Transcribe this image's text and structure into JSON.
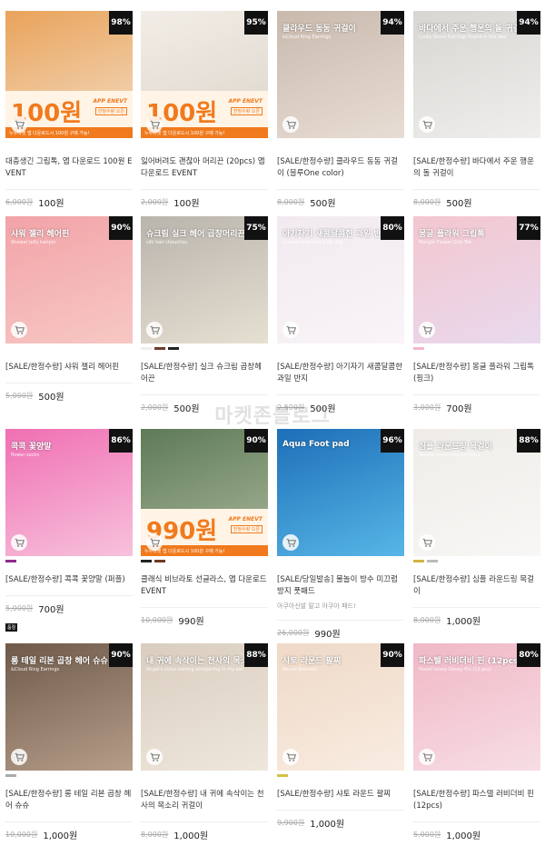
{
  "watermark": "마켓존블로그",
  "products": [
    {
      "name": "대충생긴 그립톡, 앱 다운로드 100원 EVENT",
      "old": "6,000원",
      "price": "100원",
      "discount": "98%",
      "promo": {
        "big": "100원",
        "tag": "APP ENEVT",
        "tag2": "한정수량 오픈",
        "bar": "누누마켓 앱 다운로드시 100원 구매 가능!"
      },
      "colors": [
        "#e9a35a",
        "#f3dcc3"
      ],
      "swatches": []
    },
    {
      "name": "잃어버려도 괜찮아 머리끈 (20pcs) 앱 다운로드 EVENT",
      "old": "2,000원",
      "price": "100원",
      "discount": "95%",
      "promo": {
        "big": "100원",
        "tag": "APP ENEVT",
        "tag2": "한정수량 오픈",
        "bar": "누누마켓 앱 다운로드시 100원 구매 가능!"
      },
      "colors": [
        "#f2ede6",
        "#dcd5cb"
      ],
      "swatches": []
    },
    {
      "name": "[SALE/한정수량] 클라우드 동동 귀걸이 (블루One color)",
      "old": "8,000원",
      "price": "500원",
      "discount": "94%",
      "overlay": "클라우드 동동 귀걸이",
      "overlay_sub": "&Cloud Ring Earrings",
      "colors": [
        "#c9b9ad",
        "#e8ddd4"
      ],
      "swatches": []
    },
    {
      "name": "[SALE/한정수량] 바다에서 주운 행운의 돌 귀걸이",
      "old": "8,000원",
      "price": "500원",
      "discount": "94%",
      "overlay": "바다에서 주운 행운의 돌 귀걸이",
      "overlay_sub": "Lucky Stone Earrings Found in the Sea",
      "colors": [
        "#d8d6d2",
        "#efeeec"
      ],
      "swatches": []
    },
    {
      "name": "[SALE/한정수량] 샤워 젤리 헤어핀",
      "old": "5,000원",
      "price": "500원",
      "discount": "90%",
      "overlay": "샤워 젤리 헤어핀",
      "overlay_sub": "Shower jelly hairpin",
      "colors": [
        "#f2a3a8",
        "#f7c8c4"
      ],
      "swatches": []
    },
    {
      "name": "[SALE/한정수량] 실크 슈크림 곱창헤어끈",
      "old": "2,000원",
      "price": "500원",
      "discount": "75%",
      "overlay": "슈크림 실크 헤어 곱창머리끈",
      "overlay_sub": "silk hair chouchou",
      "colors": [
        "#b9b4ac",
        "#e6e0d2"
      ],
      "swatches": [
        "#eeeeee",
        "#6b3b2a",
        "#222222"
      ]
    },
    {
      "name": "[SALE/한정수량] 아기자기 새콤달콤한 과일 반지",
      "old": "2,500원",
      "price": "500원",
      "discount": "80%",
      "overlay": "아기자기 새콤달콤한 과일 반지",
      "overlay_sub": "a sweet and sour fruit ring",
      "colors": [
        "#f1eaf0",
        "#f9f4f7"
      ],
      "swatches": []
    },
    {
      "name": "[SALE/한정수량] 몽글 플라워 그립톡 (핑크)",
      "old": "3,000원",
      "price": "700원",
      "discount": "77%",
      "overlay": "몽글 플라워 그립톡",
      "overlay_sub": "Mongle Flower Grip Tok",
      "colors": [
        "#f3c7cf",
        "#e9d9ee"
      ],
      "swatches": [
        "#f5b6c8"
      ]
    },
    {
      "name": "[SALE/한정수량] 콕콕 꽃양말 (퍼플)",
      "old": "5,000원",
      "price": "700원",
      "discount": "86%",
      "overlay": "콕콕 꽃양말",
      "overlay_sub": "flower socks",
      "colors": [
        "#f06fb3",
        "#f7c2dc"
      ],
      "swatches": [
        "#8e2b8e"
      ],
      "soldtag": "품절"
    },
    {
      "name": "클래식 비브라토 선글라스, 앱 다운로드 EVENT",
      "old": "10,000원",
      "price": "990원",
      "discount": "90%",
      "promo": {
        "big": "990원",
        "tag": "APP ENEVT",
        "tag2": "한정수량 오픈",
        "bar": "누누마켓 앱 다운로드시 100원 구매 가능!"
      },
      "colors": [
        "#5e7a56",
        "#a9b79a"
      ],
      "swatches": [
        "#222222",
        "#6b3b2a"
      ]
    },
    {
      "name": "[SALE/당일발송] 물놀이 방수 미끄럼 방지 풋패드",
      "desc": "아쿠아신발 말고 아쿠아 패드!",
      "old": "26,000원",
      "price": "990원",
      "discount": "96%",
      "overlay": "Aqua Foot pad",
      "overlay_sub": "",
      "colors": [
        "#1d6fb8",
        "#57b6e6"
      ],
      "swatches": []
    },
    {
      "name": "[SALE/한정수량] 심플 라운드링 목걸이",
      "old": "8,000원",
      "price": "1,000원",
      "discount": "88%",
      "overlay": "심플 라운드링 목걸이",
      "overlay_sub": "Simple round ring necklace",
      "colors": [
        "#efece8",
        "#f8f7f5"
      ],
      "swatches": [
        "#d4b445",
        "#bbbbbb"
      ]
    },
    {
      "name": "[SALE/한정수량] 롱 테일 리본 곱창 헤어 슈슈",
      "old": "10,000원",
      "price": "1,000원",
      "discount": "90%",
      "overlay": "롱 테일 리본 곱창 헤어 슈슈",
      "overlay_sub": "&Cloud Ring Earrings",
      "colors": [
        "#6f5a4a",
        "#b59d89"
      ],
      "swatches": [
        "#aaaaaa"
      ]
    },
    {
      "name": "[SALE/한정수량] 내 귀에 속삭이는 천사의 목소리 귀걸이",
      "old": "8,000원",
      "price": "1,000원",
      "discount": "88%",
      "overlay": "내 귀에 속삭이는 천사의 목소리",
      "overlay_sub": "Angel's voice earring whispering in my ear",
      "colors": [
        "#d9cdbf",
        "#efe7dc"
      ],
      "swatches": []
    },
    {
      "name": "[SALE/한정수량] 샤토 라운드 팔찌",
      "old": "9,900원",
      "price": "1,000원",
      "discount": "90%",
      "overlay": "샤토 라운드 팔찌",
      "overlay_sub": "Round Bracelet",
      "colors": [
        "#efd9c7",
        "#f8ece1"
      ],
      "swatches": [
        "#d4c04a"
      ]
    },
    {
      "name": "[SALE/한정수량] 파스텔 러비더비 핀 (12pcs)",
      "old": "5,000원",
      "price": "1,000원",
      "discount": "80%",
      "overlay": "파스텔 러비더비 핀 (12pcs)",
      "overlay_sub": "Pastel Lovey Dovey Pin (12 pcs)",
      "colors": [
        "#f0b8c6",
        "#f7dde4"
      ],
      "swatches": []
    }
  ]
}
